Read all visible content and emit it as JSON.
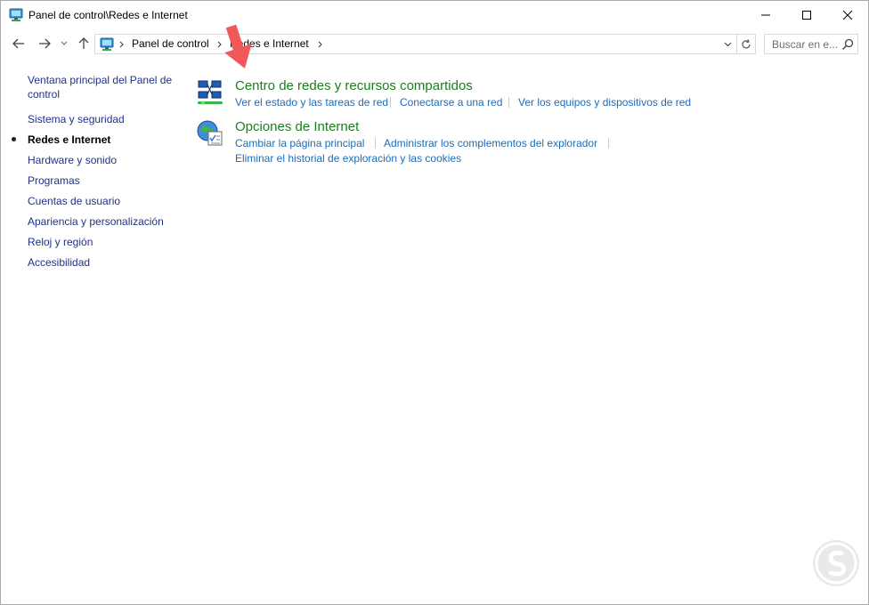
{
  "window": {
    "title": "Panel de control\\Redes e Internet"
  },
  "address": {
    "crumbs": [
      "Panel de control",
      "Redes e Internet"
    ],
    "search_placeholder": "Buscar en e..."
  },
  "sidebar": {
    "items": [
      {
        "label": "Ventana principal del Panel de control",
        "current": false
      },
      {
        "label": "Sistema y seguridad",
        "current": false
      },
      {
        "label": "Redes e Internet",
        "current": true
      },
      {
        "label": "Hardware y sonido",
        "current": false
      },
      {
        "label": "Programas",
        "current": false
      },
      {
        "label": "Cuentas de usuario",
        "current": false
      },
      {
        "label": "Apariencia y personalización",
        "current": false
      },
      {
        "label": "Reloj y región",
        "current": false
      },
      {
        "label": "Accesibilidad",
        "current": false
      }
    ]
  },
  "categories": [
    {
      "title": "Centro de redes y recursos compartidos",
      "icon": "network-sharing-center-icon",
      "links": [
        "Ver el estado y las tareas de red",
        "Conectarse a una red",
        "Ver los equipos y dispositivos de red"
      ]
    },
    {
      "title": "Opciones de Internet",
      "icon": "internet-options-icon",
      "links": [
        "Cambiar la página principal",
        "Administrar los complementos del explorador",
        "Eliminar el historial de exploración y las cookies"
      ]
    }
  ],
  "colors": {
    "link": "#1e6bb8",
    "category_title": "#1a7f1a",
    "sidebar_link": "#1e3287",
    "annotation_arrow": "#f0585a"
  }
}
